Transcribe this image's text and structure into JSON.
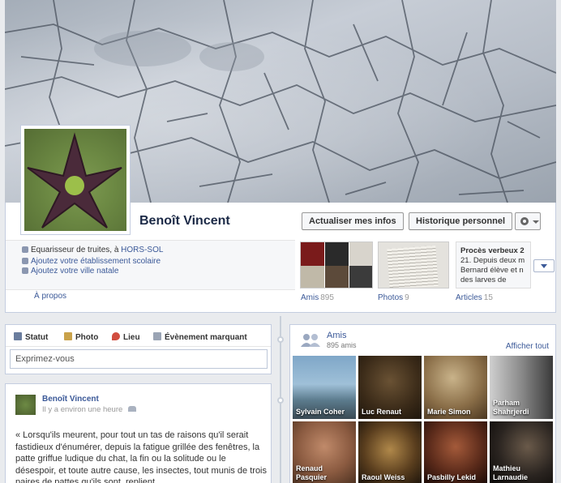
{
  "profile": {
    "name": "Benoît Vincent",
    "update_button": "Actualiser mes infos",
    "history_button": "Historique personnel"
  },
  "about": {
    "job_prefix": "Equarisseur de truites, à",
    "job_link": "HORS-SOL",
    "add_school": "Ajoutez votre établissement scolaire",
    "add_city": "Ajoutez votre ville natale",
    "about_link": "À propos"
  },
  "highlights": {
    "friends_label": "Amis",
    "friends_count": "895",
    "photos_label": "Photos",
    "photos_count": "9",
    "articles_label": "Articles",
    "articles_count": "15",
    "article_lines": [
      "Procès verbeux 2",
      "21. Depuis deux m",
      "Bernard élève et n",
      "des larves de"
    ]
  },
  "composer": {
    "tabs": [
      "Statut",
      "Photo",
      "Lieu",
      "Évènement marquant"
    ],
    "placeholder": "Exprimez-vous"
  },
  "post": {
    "author": "Benoît Vincent",
    "time": "Il y a environ une heure",
    "body": "« Lorsqu'ils meurent, pour tout un tas de raisons qu'il serait fastidieux d'énumérer, depuis la fatigue grillée des fenêtres, la patte griffue ludique du chat, la fin ou la solitude ou le désespoir, et toute autre cause, les insectes, tout munis de trois paires de pattes qu'ils sont, replient"
  },
  "friends_box": {
    "title": "Amis",
    "count": "895 amis",
    "see_all": "Afficher tout",
    "friends": [
      {
        "name": "Sylvain Coher"
      },
      {
        "name": "Luc Renaut"
      },
      {
        "name": "Marie Simon"
      },
      {
        "name": "Parham Shahrjerdi"
      },
      {
        "name": "Renaud Pasquier"
      },
      {
        "name": "Raoul Weiss"
      },
      {
        "name": "Pasbilly Lekid"
      },
      {
        "name": "Mathieu Larnaudie"
      }
    ]
  },
  "colors": {
    "link": "#3b5998",
    "border": "#c4cde0",
    "background": "#e9ebee"
  }
}
